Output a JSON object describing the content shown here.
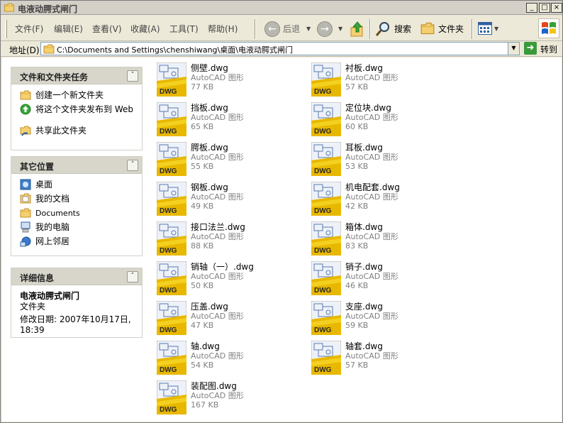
{
  "window": {
    "title": "电液动腭式闸门"
  },
  "menu": {
    "file": "文件(F)",
    "edit": "编辑(E)",
    "view": "查看(V)",
    "favorites": "收藏(A)",
    "tools": "工具(T)",
    "help": "帮助(H)"
  },
  "toolbar": {
    "back": "后退",
    "search": "搜索",
    "folders": "文件夹"
  },
  "address": {
    "label": "地址(D)",
    "path": "C:\\Documents and Settings\\chenshiwang\\桌面\\电液动腭式闸门",
    "go": "转到"
  },
  "panels": {
    "tasks": {
      "title": "文件和文件夹任务",
      "items": [
        "创建一个新文件夹",
        "将这个文件夹发布到 Web",
        "共享此文件夹"
      ]
    },
    "places": {
      "title": "其它位置",
      "items": [
        "桌面",
        "我的文档",
        "Documents",
        "我的电脑",
        "网上邻居"
      ]
    },
    "details": {
      "title": "详细信息",
      "name": "电液动腭式闸门",
      "type": "文件夹",
      "modified": "修改日期: 2007年10月17日, 18:39"
    }
  },
  "files": [
    {
      "name": "侧壁.dwg",
      "type": "AutoCAD 图形",
      "size": "77 KB"
    },
    {
      "name": "衬板.dwg",
      "type": "AutoCAD 图形",
      "size": "57 KB"
    },
    {
      "name": "挡板.dwg",
      "type": "AutoCAD 图形",
      "size": "65 KB"
    },
    {
      "name": "定位块.dwg",
      "type": "AutoCAD 图形",
      "size": "60 KB"
    },
    {
      "name": "腭板.dwg",
      "type": "AutoCAD 图形",
      "size": "55 KB"
    },
    {
      "name": "耳板.dwg",
      "type": "AutoCAD 图形",
      "size": "53 KB"
    },
    {
      "name": "钢板.dwg",
      "type": "AutoCAD 图形",
      "size": "49 KB"
    },
    {
      "name": "机电配套.dwg",
      "type": "AutoCAD 图形",
      "size": "42 KB"
    },
    {
      "name": "接口法兰.dwg",
      "type": "AutoCAD 图形",
      "size": "88 KB"
    },
    {
      "name": "箱体.dwg",
      "type": "AutoCAD 图形",
      "size": "83 KB"
    },
    {
      "name": "销轴（一）.dwg",
      "type": "AutoCAD 图形",
      "size": "50 KB"
    },
    {
      "name": "销子.dwg",
      "type": "AutoCAD 图形",
      "size": "46 KB"
    },
    {
      "name": "压盖.dwg",
      "type": "AutoCAD 图形",
      "size": "47 KB"
    },
    {
      "name": "支座.dwg",
      "type": "AutoCAD 图形",
      "size": "59 KB"
    },
    {
      "name": "轴.dwg",
      "type": "AutoCAD 图形",
      "size": "54 KB"
    },
    {
      "name": "轴套.dwg",
      "type": "AutoCAD 图形",
      "size": "57 KB"
    },
    {
      "name": "装配图.dwg",
      "type": "AutoCAD 图形",
      "size": "167 KB"
    }
  ],
  "icons": {
    "file": "dwg-file-icon",
    "badge": "DWG"
  }
}
